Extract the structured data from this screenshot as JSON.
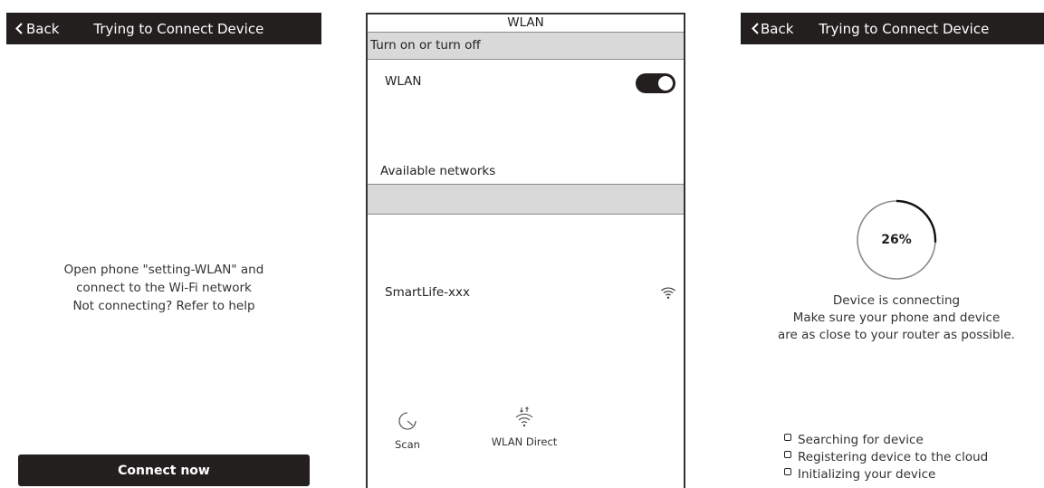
{
  "left_screen": {
    "back_label": "Back",
    "title": "Trying to Connect Device",
    "instructions": [
      "Open phone \"setting-WLAN\" and",
      "connect to the Wi-Fi network",
      "Not connecting? Refer to help"
    ],
    "connect_button": "Connect now"
  },
  "wlan_screen": {
    "title": "WLAN",
    "toggle_section": "Turn on or turn off",
    "wlan_label": "WLAN",
    "wlan_on": true,
    "available_label": "Available networks",
    "networks": [
      {
        "name": "SmartLife-xxx",
        "icon": "wifi-icon"
      }
    ],
    "actions": [
      {
        "label": "Scan",
        "icon": "scan-icon"
      },
      {
        "label": "WLAN Direct",
        "icon": "wifi-direct-icon"
      }
    ]
  },
  "right_screen": {
    "back_label": "Back",
    "title": "Trying to Connect Device",
    "progress_percent": 26,
    "progress_label": "26%",
    "status_lines": [
      "Device is connecting",
      "Make sure your phone and device",
      "are as close to your router as possible."
    ],
    "steps": [
      "Searching for device",
      "Registering device to the cloud",
      "Initializing your device"
    ]
  },
  "colors": {
    "dark_bar": "#231f1f",
    "gray_bar": "#d9d9d9",
    "progress_track": "#8a8a8a",
    "progress_fill": "#111111"
  }
}
